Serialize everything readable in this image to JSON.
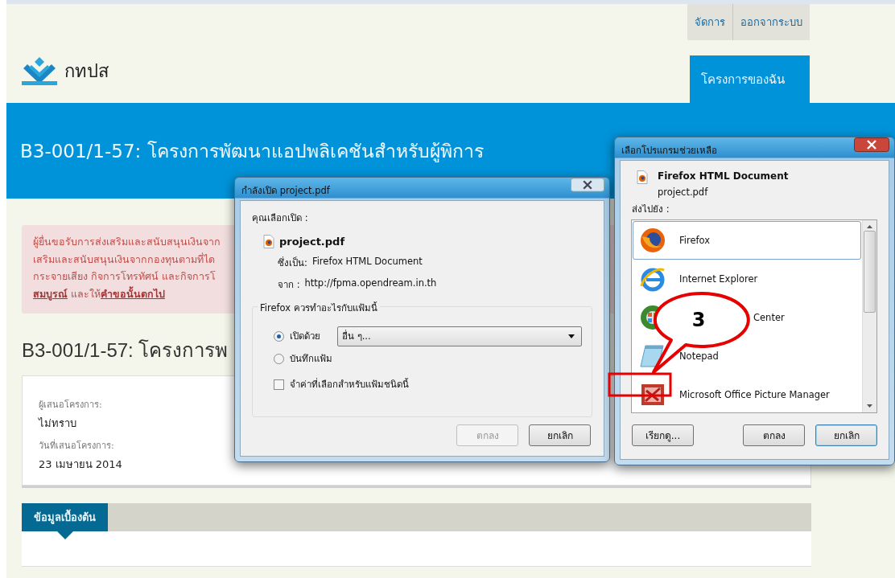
{
  "site": {
    "top_links": [
      "จัดการ",
      "ออกจากระบบ"
    ],
    "logo_text": "กทปส",
    "nav_tabs": [
      {
        "label": "โครงการของฉัน",
        "selected": true
      }
    ],
    "banner_title": "B3-001/1-57: โครงการพัฒนาแอปพลิเคชันสำหรับผู้พิการ",
    "alert": {
      "lines": [
        "ผู้ยื่นขอรับการส่งเสริมและสนับสนุนเงินจาก",
        "เสริมและสนับสนุนเงินจากกองทุนตามที่ได",
        "กระจายเสียง กิจการโทรทัศน์ และกิจการโ"
      ],
      "last_line": [
        {
          "kind": "link",
          "text": "สมบูรณ์"
        },
        {
          "kind": "text",
          "text": " และให้"
        },
        {
          "kind": "link",
          "text": "คำขอนั้นตกไป"
        }
      ]
    },
    "heading": "B3-001/1-57: โครงการพ",
    "fields": [
      {
        "label": "ผู้เสนอโครงการ:",
        "value": "ไม่ทราบ"
      },
      {
        "label": "วันที่เสนอโครงการ:",
        "value": "23 เมษายน 2014"
      }
    ],
    "section_tabs": [
      {
        "label": "ข้อมูลเบื้องต้น",
        "selected": true
      }
    ]
  },
  "open_dialog": {
    "title": "กำลังเปิด project.pdf",
    "intro": "คุณเลือกเปิด :",
    "file_name": "project.pdf",
    "type_label": "ซึ่งเป็น:",
    "type_value": "Firefox HTML Document",
    "from_label": "จาก :",
    "from_value": "http://fpma.opendream.in.th",
    "group_title": "Firefox ควรทำอะไรกับแฟ้มนี้",
    "options": [
      {
        "label": "เปิดด้วย",
        "selected": true
      },
      {
        "label": "บันทึกแฟ้ม",
        "selected": false
      }
    ],
    "open_with": "อื่น ๆ...",
    "remember": {
      "label": "จำค่าที่เลือกสำหรับแฟ้มชนิดนี้",
      "checked": false
    },
    "buttons": [
      {
        "label": "ตกลง",
        "disabled": true
      },
      {
        "label": "ยกเลิก",
        "disabled": false
      }
    ]
  },
  "choose_dialog": {
    "title": "เลือกโปรแกรมช่วยเหลือ",
    "doc_type": "Firefox HTML Document",
    "file_name": "project.pdf",
    "send_to_label": "ส่งไปยัง :",
    "apps": [
      {
        "kind": "firefox",
        "label": "Firefox",
        "selected": true
      },
      {
        "kind": "ie",
        "label": "Internet Explorer",
        "selected": false
      },
      {
        "kind": "mediacenter",
        "label": "Center",
        "selected": false
      },
      {
        "kind": "notepad",
        "label": "Notepad",
        "selected": false
      },
      {
        "kind": "picture",
        "label": "Microsoft Office Picture Manager",
        "selected": false
      }
    ],
    "buttons": [
      {
        "label": "เรียกดู...",
        "default": false
      },
      {
        "label": "ตกลง",
        "default": false
      },
      {
        "label": "ยกเลิก",
        "default": true
      }
    ]
  },
  "callout": {
    "number": "3"
  }
}
